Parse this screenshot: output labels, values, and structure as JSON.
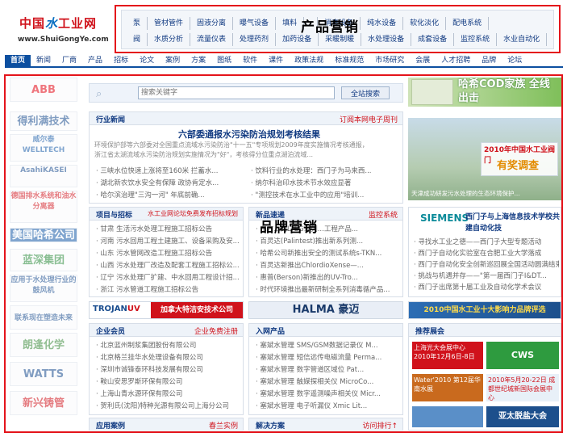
{
  "site": {
    "logo_cn": "中国水工业网",
    "logo_url": "www.ShuiGongYe.com"
  },
  "product_menu": {
    "row1": [
      "泵",
      "管材管件",
      "固液分离",
      "曝气设备",
      "填料",
      "",
      "消毒设备",
      "纯水设备",
      "软化淡化",
      "配电系统"
    ],
    "row2": [
      "阀",
      "水质分析",
      "流量仪表",
      "处理药剂",
      "加药设备",
      "采暖制暖",
      "水处理设备",
      "成套设备",
      "监控系统",
      "水业自动化"
    ]
  },
  "labels": {
    "product_marketing": "产品营销",
    "brand_marketing": "品牌营销"
  },
  "nav": [
    "首页",
    "新闻",
    "厂商",
    "产品",
    "招标",
    "论文",
    "案例",
    "方案",
    "图纸",
    "软件",
    "课件",
    "政策法规",
    "标准规范",
    "市场研究",
    "会展",
    "人才招聘",
    "品牌",
    "论坛"
  ],
  "left_logos": [
    {
      "text": "ABB",
      "color": "#e30613"
    },
    {
      "text": "得利满技术",
      "color": "#1a4d8f"
    },
    {
      "text": "威尔泰 WELLTECH",
      "color": "#1a5ca8"
    },
    {
      "text": "AsahiKASEI",
      "color": "#1a4d8f"
    },
    {
      "text": "德国排水系统和油水分离器",
      "color": "#d0121b"
    },
    {
      "text": "美国哈希公司",
      "color": "#ffffff"
    },
    {
      "text": "蓝深集团",
      "color": "#2a8a3a"
    },
    {
      "text": "应用于水处理行业的鼓风机",
      "color": "#1a4d8f"
    },
    {
      "text": "联系现在塑造未来",
      "color": "#1a4d8f"
    },
    {
      "text": "朗逢化学",
      "color": "#3a8a3a"
    },
    {
      "text": "WATTS",
      "color": "#1a4d8f"
    },
    {
      "text": "新兴铸管",
      "color": "#d0121b"
    }
  ],
  "search": {
    "placeholder": "搜索关键字",
    "button": "全站搜索"
  },
  "industry_news": {
    "title": "行业新闻",
    "more": "订阅本网电子周刊",
    "headline": "六部委通报水污染防治规划考核结果",
    "summary1": "环境保护部等六部委对全国重点流域水污染防治\"十一五\"专项规划2009年度实施情况考核通报，",
    "summary2": "浙江省太湖流域水污染防治规划实施情况为\"好\"，考核得分位重点湖泊流域...",
    "left_items": [
      "三峡水位快速上涨将至160米 拦蓄水...",
      "湖北新农饮水安全有保障 政协肯定水...",
      "哈尔滨治理\"三沟一河\" 年底前确..."
    ],
    "right_items": [
      "饮料行业的水处理：西门子为马来西...",
      "纳尔科治印水技术节水效应显著",
      "\"测控技术在水工业中的应用\"培训..."
    ]
  },
  "project_bidding": {
    "title": "项目与招标",
    "more": "水工业网论坛免费发布招标规划",
    "items": [
      "甘肃 生活污水处理工程施工招标公告",
      "河南 污水回用工程土建施工、设备采购及安...",
      "山东 污水管网改造工程施工招标公告",
      "山西 污水处理厂改造及配套工程施工招标公...",
      "辽宁 污水处理厂扩建、中水回用工程设计招...",
      "浙江 污水管道工程施工招标公告"
    ]
  },
  "new_products": {
    "title": "新品速递",
    "more": "监控系统",
    "items": [
      "东方...的LTEG系列...工程产品...",
      "百灵达(Palintest)推出新系列测...",
      "哈希公司新推出安全的测试系统s-TKN...",
      "百灵达新推出ChlordioXense—...",
      "惠普(Berson)新推出的UV-Tro...",
      "时代环境推出最新研制全系列消毒循产品..."
    ]
  },
  "banners": {
    "trojan": "加拿大特洁安技术公司",
    "halma": "HALMA 豪迈",
    "top10": "2010中国水工业十大影响力品牌评选"
  },
  "members": {
    "title": "企业会员",
    "more": "企业免费注册",
    "items": [
      "北京蓝州制浆集团股份有限公司",
      "北京格兰挂华水处理设备有限公司",
      "深圳市诚锋泰环科技发展有限公司",
      "鞍山安思罗斯环保有限公司",
      "上海山青水源环保有限公司",
      "贺利氏(沈阳)特种光源有限公司上海分公司"
    ]
  },
  "entry_products": {
    "title": "入网产品",
    "items": [
      "塞斌水管理 SMS/GSM数据记录仪 M...",
      "塞斌水管理 短信远传电磁流量 Perma...",
      "塞斌水管理 数字管道区域位 Pat...",
      "塞斌水管理 触媒探相关仪 MicroCo...",
      "塞斌水管理 数字遥测噪声相关仪 Micr...",
      "塞斌水管理 电子听漏仪 Xmic Lit..."
    ]
  },
  "cases": {
    "title": "应用案例",
    "more": "春兰实例"
  },
  "solutions": {
    "title": "解决方案",
    "more": "访问排行↑"
  },
  "right_column": {
    "hach_banner": "哈希COD家族 全线出击",
    "valve_title": "2010年中国水工业阀门",
    "valve_prize": "有奖调查",
    "valve_caption": "天津成功研发污水处理的生态环境保护...",
    "siemens": "SIEMENS",
    "siemens_title": "西门子与上海信息技术学校共建自动化技",
    "siemens_items": [
      "寻找水工业之德——西门子大型专题活动",
      "西门子自动化实验室在合肥工业大学落成",
      "西门子自动化安全创新巡回展全国活动圆满结束",
      "挑战与机遇并存——\"第一届西门子I&DT...",
      "西门子出席第十届工业及自动化学术会议"
    ],
    "expo_title": "推荐展会",
    "expo1": "上海光大会展中心 2010年12月6日-8日",
    "expo2": "Water'2010 第12届华南水展",
    "expo3": "2010年5月20-22日 成都世纪城新国际会展中心",
    "expo4": "亚太脱盐大会"
  },
  "colors": {
    "accent_red": "#e4141b",
    "nav_blue": "#0c4fa0",
    "hach_green": "#2f8f2f"
  }
}
